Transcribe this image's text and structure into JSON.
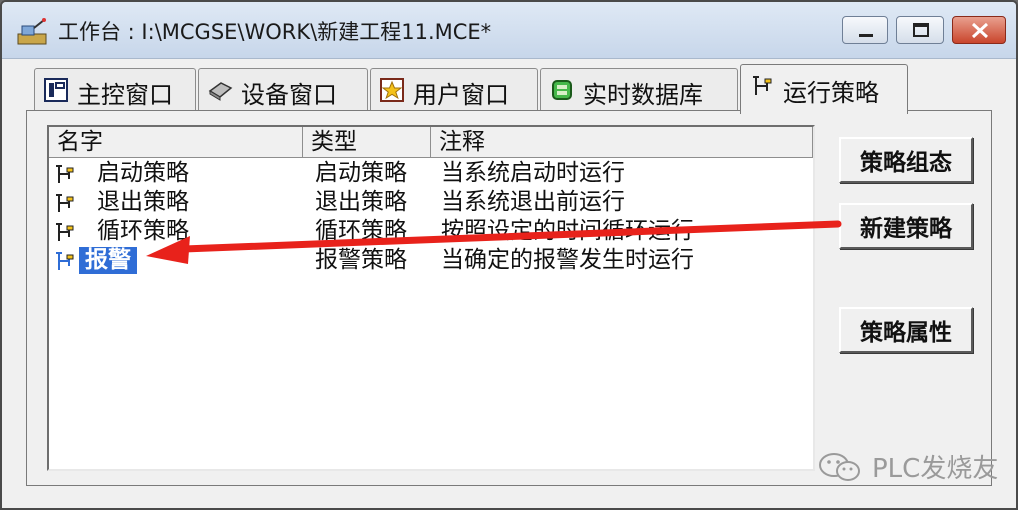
{
  "window": {
    "title": "工作台 : I:\\MCGSE\\WORK\\新建工程11.MCE*"
  },
  "tabs": [
    {
      "label": "主控窗口",
      "icon": "main-window-icon"
    },
    {
      "label": "设备窗口",
      "icon": "device-window-icon"
    },
    {
      "label": "用户窗口",
      "icon": "user-window-icon"
    },
    {
      "label": "实时数据库",
      "icon": "database-icon"
    },
    {
      "label": "运行策略",
      "icon": "strategy-icon",
      "active": true
    }
  ],
  "list": {
    "columns": [
      "名字",
      "类型",
      "注释"
    ],
    "rows": [
      {
        "name": "启动策略",
        "type": "启动策略",
        "note": "当系统启动时运行"
      },
      {
        "name": "退出策略",
        "type": "退出策略",
        "note": "当系统退出前运行"
      },
      {
        "name": "循环策略",
        "type": "循环策略",
        "note": "按照设定的时间循环运行"
      },
      {
        "name": "报警",
        "type": "报警策略",
        "note": "当确定的报警发生时运行",
        "editing": true
      }
    ]
  },
  "buttons": {
    "configure": "策略组态",
    "new": "新建策略",
    "properties": "策略属性"
  },
  "watermark": {
    "text": "PLC发烧友"
  },
  "colors": {
    "selection": "#2f6dd6",
    "annotation_arrow": "#e8221b"
  }
}
